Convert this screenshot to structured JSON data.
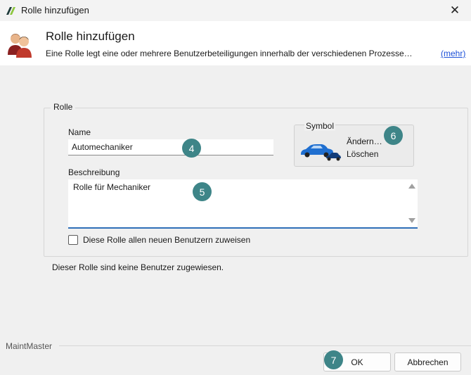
{
  "window": {
    "title": "Rolle hinzufügen",
    "close_glyph": "✕"
  },
  "header": {
    "title": "Rolle hinzufügen",
    "description": "Eine Rolle legt eine oder mehrere Benutzerbeteiligungen innerhalb der verschiedenen Prozesse…",
    "more_link": "(mehr)",
    "icon": "users-icon"
  },
  "form": {
    "group_label": "Rolle",
    "name_label": "Name",
    "name_value": "Automechaniker",
    "description_label": "Beschreibung",
    "description_value": "Rolle für Mechaniker",
    "assign_all_checkbox": {
      "label": "Diese Rolle allen neuen Benutzern zuweisen",
      "checked": false
    },
    "symbol": {
      "label": "Symbol",
      "change_label": "Ändern…",
      "delete_label": "Löschen",
      "icon": "car-icon"
    }
  },
  "status_text": "Dieser Rolle sind keine Benutzer zugewiesen.",
  "annotations": {
    "n4": "4",
    "n5": "5",
    "n6": "6",
    "n7": "7"
  },
  "footer": {
    "brand": "MaintMaster",
    "ok_label": "OK",
    "cancel_label": "Abbrechen"
  },
  "colors": {
    "accent": "#2f6fb8",
    "bubble": "#3e8588",
    "link": "#1a4fd8"
  }
}
